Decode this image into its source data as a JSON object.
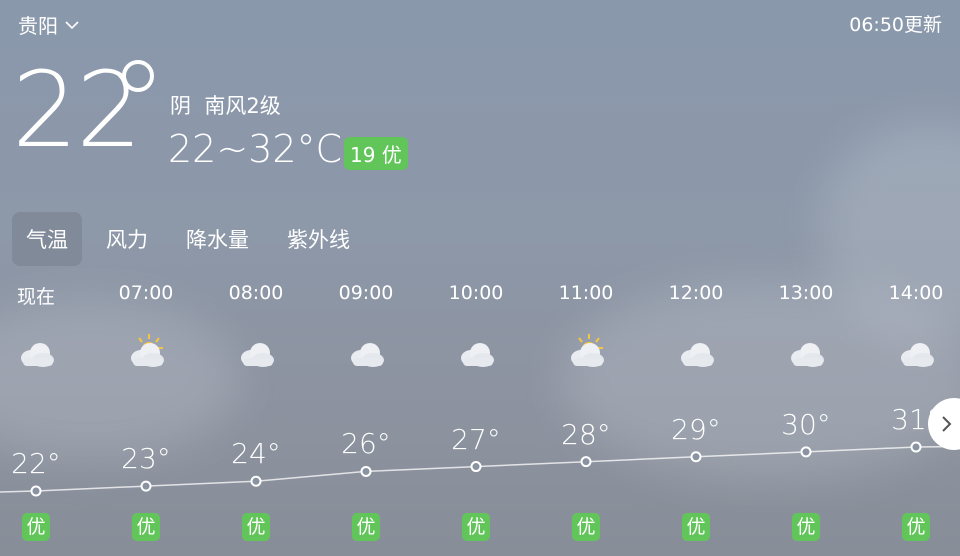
{
  "header": {
    "city": "贵阳",
    "update_text": "06:50更新"
  },
  "current": {
    "temp": "22",
    "condition": "阴",
    "wind": "南风2级",
    "range": "22~32°C",
    "aqi": "19 优"
  },
  "tabs": [
    {
      "label": "气温",
      "active": true
    },
    {
      "label": "风力",
      "active": false
    },
    {
      "label": "降水量",
      "active": false
    },
    {
      "label": "紫外线",
      "active": false
    }
  ],
  "hourly": [
    {
      "time": "现在",
      "icon": "cloudy",
      "temp": 22,
      "temp_label": "22°",
      "aqi": "优"
    },
    {
      "time": "07:00",
      "icon": "sun-cloud",
      "temp": 23,
      "temp_label": "23°",
      "aqi": "优"
    },
    {
      "time": "08:00",
      "icon": "cloudy",
      "temp": 24,
      "temp_label": "24°",
      "aqi": "优"
    },
    {
      "time": "09:00",
      "icon": "cloudy",
      "temp": 26,
      "temp_label": "26°",
      "aqi": "优"
    },
    {
      "time": "10:00",
      "icon": "cloudy",
      "temp": 27,
      "temp_label": "27°",
      "aqi": "优"
    },
    {
      "time": "11:00",
      "icon": "sun-cloud",
      "temp": 28,
      "temp_label": "28°",
      "aqi": "优"
    },
    {
      "time": "12:00",
      "icon": "cloudy",
      "temp": 29,
      "temp_label": "29°",
      "aqi": "优"
    },
    {
      "time": "13:00",
      "icon": "cloudy",
      "temp": 30,
      "temp_label": "30°",
      "aqi": "优"
    },
    {
      "time": "14:00",
      "icon": "cloudy",
      "temp": 31,
      "temp_label": "31°",
      "aqi": "优"
    }
  ],
  "colors": {
    "aqi_good": "#62c55a",
    "background": "#8a98ac",
    "sun": "#f6c443"
  },
  "icons": {
    "city_dropdown": "chevron-down-icon",
    "next": "chevron-right-icon"
  }
}
